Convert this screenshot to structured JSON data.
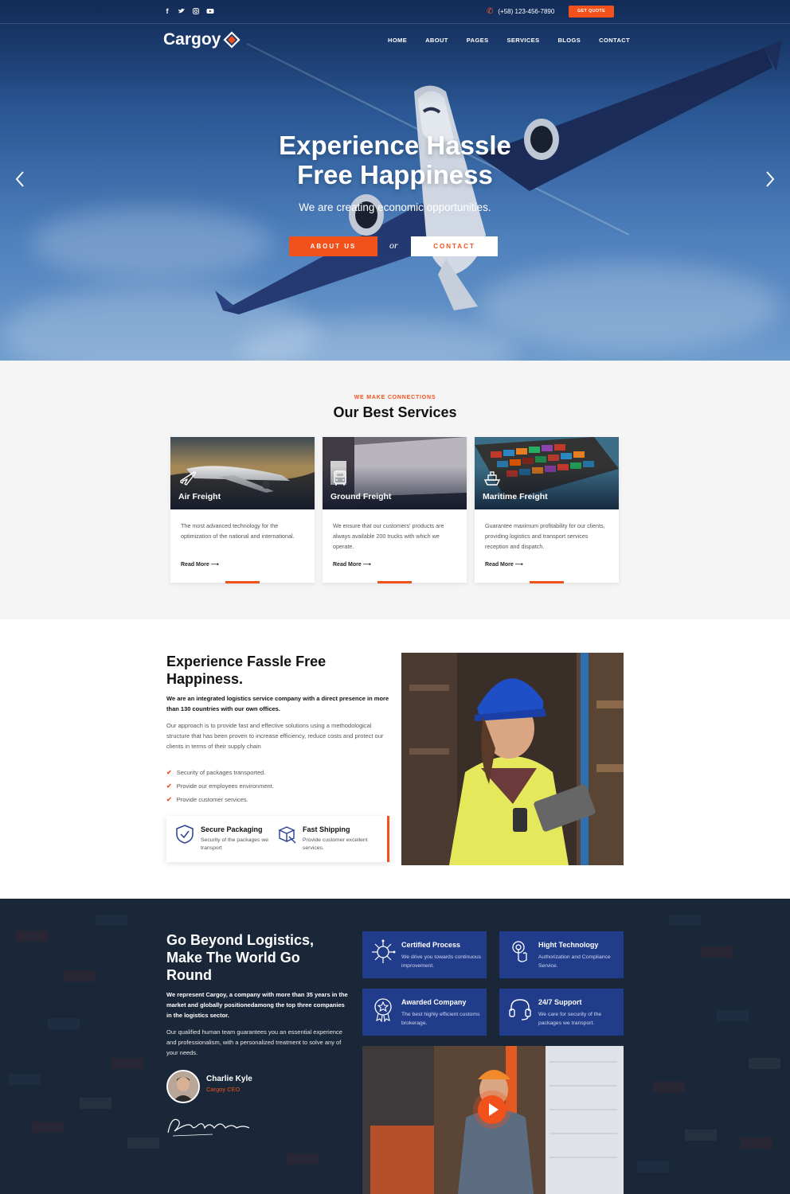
{
  "topbar": {
    "social": [
      "f",
      "t",
      "ig",
      "yt"
    ],
    "phone": "(+58) 123-456-7890",
    "quote_button": "GET QUOTE"
  },
  "brand": {
    "name": "Cargoy",
    "accent": "#f2511b",
    "navy": "#213c8a"
  },
  "nav": [
    "HOME",
    "ABOUT",
    "PAGES",
    "SERVICES",
    "BLOGS",
    "CONTACT"
  ],
  "hero": {
    "title_line1": "Experience Hassle",
    "title_line2": "Free Happiness",
    "subtitle": "We are creating economic opportunities.",
    "primary_button": "ABOUT US",
    "or": "or",
    "secondary_button": "CONTACT"
  },
  "services": {
    "eyebrow": "WE MAKE CONNECTIONS",
    "title": "Our Best Services",
    "cards": [
      {
        "title": "Air Freight",
        "icon": "airplane-icon",
        "text": "The most advanced technology for the optimization of the national and international.",
        "link": "Read More"
      },
      {
        "title": "Ground Freight",
        "icon": "truck-icon",
        "text": "We ensure that our customers' products are always available 200 trucks with which we operate.",
        "link": "Read More"
      },
      {
        "title": "Maritime Freight",
        "icon": "ship-icon",
        "text": "Guarantee maximum profitability for our clients, providing logistics and transport services reception and dispatch.",
        "link": "Read More"
      }
    ]
  },
  "about": {
    "title": "Experience Fassle Free Happiness.",
    "lead": "We are an integrated logistics service company with a direct presence in more than 130 countries with our own offices.",
    "text": "Our approach is to provide fast and effective solutions using a methodological structure that has been proven to increase efficiency, reduce costs and protect our clients in terms of their supply chain",
    "list": [
      "Security of packages transported.",
      "Provide our employees environment.",
      "Provide customer services."
    ],
    "features": [
      {
        "title": "Secure Packaging",
        "text": "Security of the packages we transport"
      },
      {
        "title": "Fast Shipping",
        "text": "Provide customer excellent services."
      }
    ]
  },
  "logistics": {
    "title": "Go Beyond Logistics, Make The World Go Round",
    "lead": "We represent Cargoy, a company with more than 35 years in the market and globally positionedamong the top three companies in the logistics sector.",
    "text": "Our qualified human team guarantees you an essential experience and professionalism, with a personalized treatment to solve any of your needs.",
    "ceo_name": "Charlie Kyle",
    "ceo_role": "Cargoy CEO",
    "tiles": [
      {
        "title": "Certified Process",
        "text": "We drive you towards continuous improvement."
      },
      {
        "title": "Hight Technology",
        "text": "Authorization and Compliance Service."
      },
      {
        "title": "Awarded Company",
        "text": "The best highly efficient customs brokerage."
      },
      {
        "title": "24/7 Support",
        "text": "We care for security of the packages we transport."
      }
    ]
  }
}
